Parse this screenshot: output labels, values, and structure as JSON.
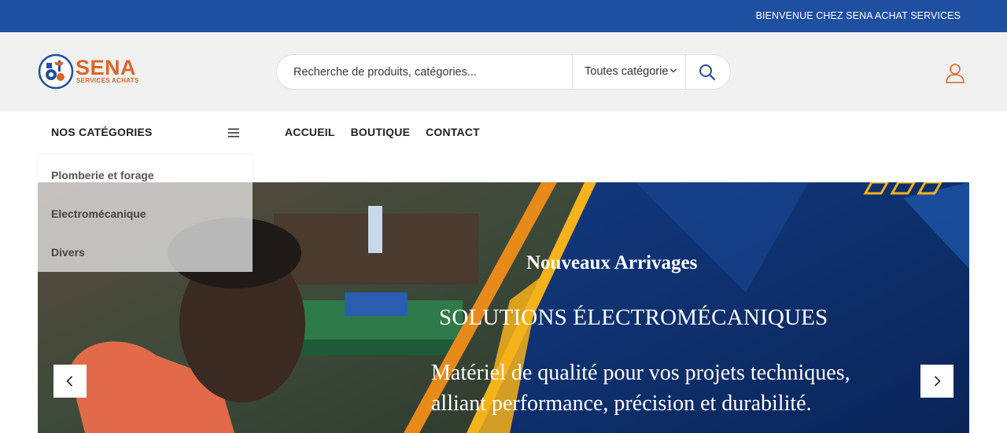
{
  "topbar": {
    "welcome": "BIENVENUE CHEZ SENA ACHAT SERVICES"
  },
  "logo": {
    "brand": "SENA",
    "tagline": "SERVICES ACHATS"
  },
  "search": {
    "placeholder": "Recherche de produits, catégories...",
    "category_select": "Toutes catégorie"
  },
  "nav": {
    "categories_title": "NOS CATÉGORIES",
    "menu": [
      "ACCUEIL",
      "BOUTIQUE",
      "CONTACT"
    ]
  },
  "categories": [
    "Plomberie et forage",
    "Electromécanique",
    "Divers"
  ],
  "hero": {
    "title": "Nouveaux Arrivages",
    "subtitle": "SOLUTIONS ÉLECTROMÉCANIQUES",
    "desc_line1": "Matériel de qualité pour vos projets techniques,",
    "desc_line2": "alliant performance, précision et durabilité."
  },
  "colors": {
    "topbar": "#1f4fa0",
    "brand_orange": "#d9662a",
    "hero_blue": "#0d3070",
    "accent_yellow": "#f6b21a"
  },
  "icons": [
    "logo-mark-icon",
    "chevron-down-icon",
    "search-icon",
    "user-icon",
    "hamburger-menu-icon",
    "chevron-left-icon",
    "chevron-right-icon"
  ]
}
